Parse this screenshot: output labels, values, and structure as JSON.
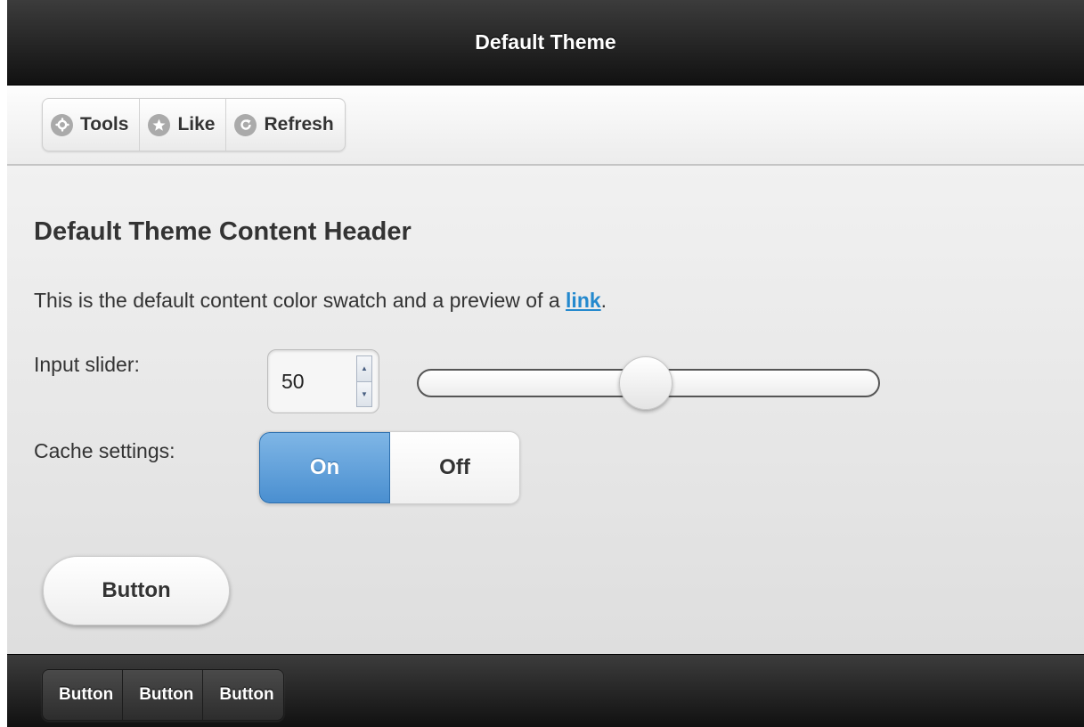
{
  "header": {
    "title": "Default Theme"
  },
  "toolbar": {
    "buttons": [
      {
        "label": "Tools",
        "icon": "gear-icon"
      },
      {
        "label": "Like",
        "icon": "star-icon"
      },
      {
        "label": "Refresh",
        "icon": "refresh-icon"
      }
    ]
  },
  "content": {
    "header": "Default Theme Content Header",
    "text_before_link": "This is the default content color swatch and a preview of a ",
    "link_text": "link",
    "text_after_link": ".",
    "slider": {
      "label": "Input slider:",
      "value": "50",
      "min": 0,
      "max": 100
    },
    "cache": {
      "label": "Cache settings:",
      "on_label": "On",
      "off_label": "Off",
      "selected": "On"
    },
    "button_label": "Button"
  },
  "footer": {
    "buttons": [
      "Button",
      "Button",
      "Button"
    ]
  },
  "colors": {
    "link": "#2489ce",
    "toggle_on": "#4a8fd0",
    "bar_dark": "#111111"
  }
}
